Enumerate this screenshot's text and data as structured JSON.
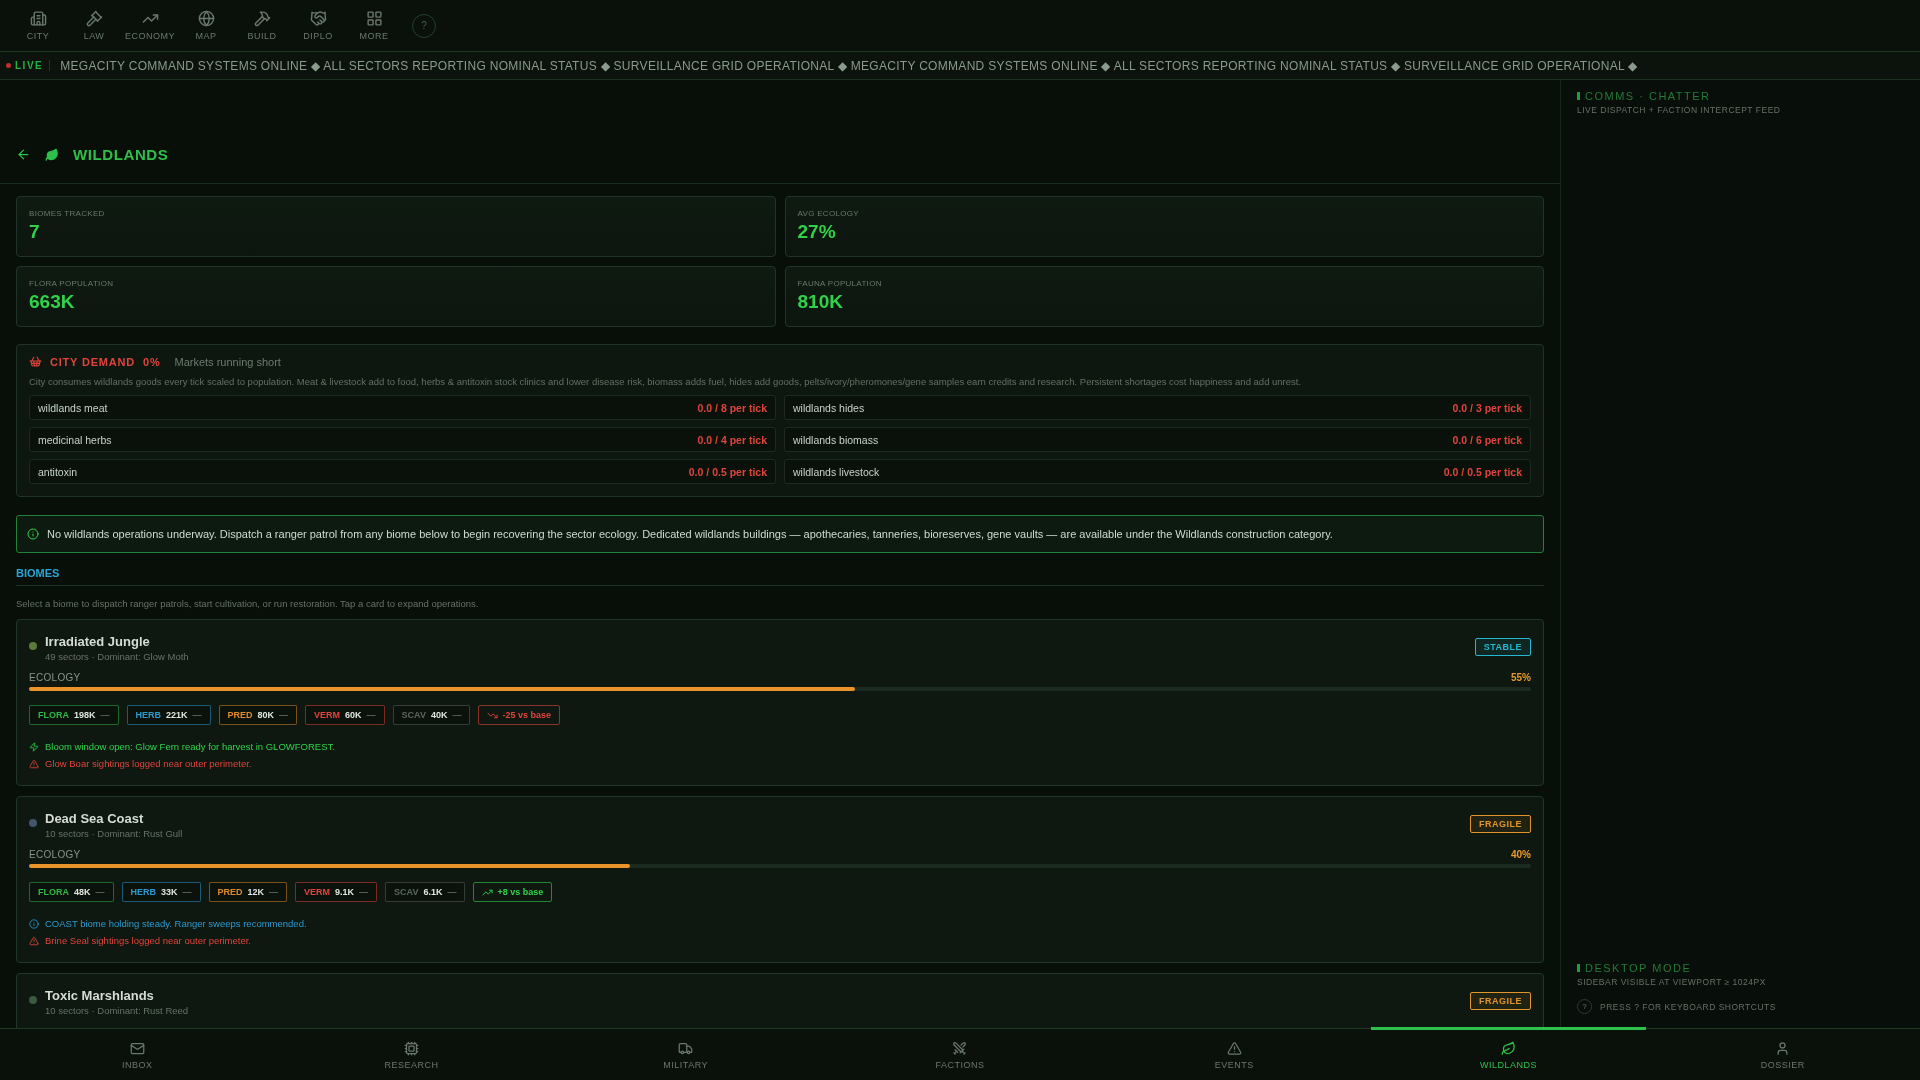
{
  "top_nav": {
    "items": [
      {
        "label": "CITY",
        "kind": "city"
      },
      {
        "label": "LAW",
        "kind": "law"
      },
      {
        "label": "ECONOMY",
        "kind": "economy"
      },
      {
        "label": "MAP",
        "kind": "map"
      },
      {
        "label": "BUILD",
        "kind": "build"
      },
      {
        "label": "DIPLO",
        "kind": "diplo"
      },
      {
        "label": "MORE",
        "kind": "more"
      }
    ],
    "help": "?"
  },
  "ticker": {
    "badge": "LIVE",
    "text": "MEGACITY COMMAND SYSTEMS ONLINE ◆ ALL SECTORS REPORTING NOMINAL STATUS ◆ SURVEILLANCE GRID OPERATIONAL ◆ MEGACITY COMMAND SYSTEMS ONLINE ◆ ALL SECTORS REPORTING NOMINAL STATUS ◆ SURVEILLANCE GRID OPERATIONAL ◆"
  },
  "header": {
    "title": "WILDLANDS"
  },
  "stats": [
    {
      "label": "BIOMES TRACKED",
      "value": "7"
    },
    {
      "label": "AVG ECOLOGY",
      "value": "27%"
    },
    {
      "label": "FLORA POPULATION",
      "value": "663K"
    },
    {
      "label": "FAUNA POPULATION",
      "value": "810K"
    }
  ],
  "city_demand": {
    "title": "CITY DEMAND",
    "percent": "0%",
    "status": "Markets running short",
    "description": "City consumes wildlands goods every tick scaled to population. Meat & livestock add to food, herbs & antitoxin stock clinics and lower disease risk, biomass adds fuel, hides add goods, pelts/ivory/pheromones/gene samples earn credits and research. Persistent shortages cost happiness and add unrest.",
    "items": [
      {
        "name": "wildlands meat",
        "rate": "0.0 / 8 per tick"
      },
      {
        "name": "wildlands hides",
        "rate": "0.0 / 3 per tick"
      },
      {
        "name": "medicinal herbs",
        "rate": "0.0 / 4 per tick"
      },
      {
        "name": "wildlands biomass",
        "rate": "0.0 / 6 per tick"
      },
      {
        "name": "antitoxin",
        "rate": "0.0 / 0.5 per tick"
      },
      {
        "name": "wildlands livestock",
        "rate": "0.0 / 0.5 per tick"
      }
    ]
  },
  "notice": "No wildlands operations underway. Dispatch a ranger patrol from any biome below to begin recovering the sector ecology. Dedicated wildlands buildings — apothecaries, tanneries, bioreserves, gene vaults — are available under the Wildlands construction category.",
  "biomes": {
    "title": "BIOMES",
    "hint": "Select a biome to dispatch ranger patrols, start cultivation, or run restoration. Tap a card to expand operations.",
    "cards": [
      {
        "name": "Irradiated Jungle",
        "subtitle": "49 sectors · Dominant: Glow Moth",
        "color": "#5b7a3c",
        "badge": {
          "kind": "stable",
          "text": "STABLE"
        },
        "ecology_label": "ECOLOGY",
        "level": 0.55,
        "reading": "55%",
        "chips": [
          {
            "kind": "flora",
            "label": "FLORA",
            "value": "198K",
            "trend": "—"
          },
          {
            "kind": "herb",
            "label": "HERB",
            "value": "221K",
            "trend": "—"
          },
          {
            "kind": "pred",
            "label": "PRED",
            "value": "80K",
            "trend": "—"
          },
          {
            "kind": "verm",
            "label": "VERM",
            "value": "60K",
            "trend": "—"
          },
          {
            "kind": "scav",
            "label": "SCAV",
            "value": "40K",
            "trend": "—"
          }
        ],
        "delta": {
          "kind": "down",
          "text": "-25 vs base"
        },
        "notes": [
          {
            "kind": "bloom",
            "text": "Bloom window open: Glow Fern ready for harvest in GLOWFOREST."
          },
          {
            "kind": "warning",
            "text": "Glow Boar sightings logged near outer perimeter."
          }
        ]
      },
      {
        "name": "Dead Sea Coast",
        "subtitle": "10 sectors · Dominant: Rust Gull",
        "color": "#44546a",
        "badge": {
          "kind": "fragile",
          "text": "FRAGILE"
        },
        "ecology_label": "ECOLOGY",
        "level": 0.4,
        "reading": "40%",
        "chips": [
          {
            "kind": "flora",
            "label": "FLORA",
            "value": "48K",
            "trend": "—"
          },
          {
            "kind": "herb",
            "label": "HERB",
            "value": "33K",
            "trend": "—"
          },
          {
            "kind": "pred",
            "label": "PRED",
            "value": "12K",
            "trend": "—"
          },
          {
            "kind": "verm",
            "label": "VERM",
            "value": "9.1K",
            "trend": "—"
          },
          {
            "kind": "scav",
            "label": "SCAV",
            "value": "6.1K",
            "trend": "—"
          }
        ],
        "delta": {
          "kind": "up",
          "text": "+8 vs base"
        },
        "notes": [
          {
            "kind": "info",
            "text": "COAST biome holding steady. Ranger sweeps recommended."
          },
          {
            "kind": "warning",
            "text": "Brine Seal sightings logged near outer perimeter."
          }
        ]
      },
      {
        "name": "Toxic Marshlands",
        "subtitle": "10 sectors · Dominant: Rust Reed",
        "color": "#3c5a3c",
        "badge": {
          "kind": "fragile",
          "text": "FRAGILE"
        }
      }
    ]
  },
  "sidebar": {
    "title": "COMMS · CHATTER",
    "subtitle": "LIVE DISPATCH + FACTION INTERCEPT FEED",
    "mode_title": "DESKTOP MODE",
    "mode_text": "SIDEBAR VISIBLE AT VIEWPORT ≥ 1024PX",
    "shortcut_key": "?",
    "shortcut_text": "PRESS ? FOR KEYBOARD SHORTCUTS"
  },
  "bottom_nav": [
    {
      "label": "INBOX",
      "kind": "inbox",
      "selected": false
    },
    {
      "label": "RESEARCH",
      "kind": "research",
      "selected": false
    },
    {
      "label": "MILITARY",
      "kind": "military",
      "selected": false
    },
    {
      "label": "FACTIONS",
      "kind": "factions",
      "selected": false
    },
    {
      "label": "EVENTS",
      "kind": "events",
      "selected": false
    },
    {
      "label": "WILDLANDS",
      "kind": "wildlands",
      "selected": true
    },
    {
      "label": "DOSSIER",
      "kind": "dossier",
      "selected": false
    }
  ]
}
